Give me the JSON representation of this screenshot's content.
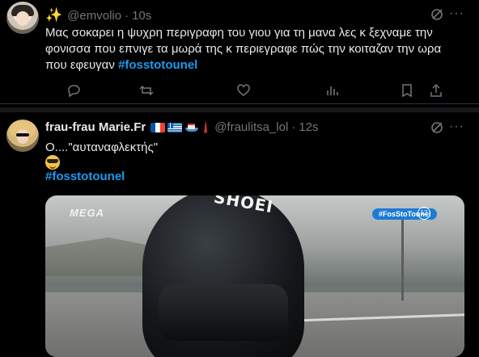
{
  "tweet1": {
    "handle": "@emvolio",
    "time": "10s",
    "text": "Μας σοκαρει η ψυχρη περιγραφη του γιου για τη μανα λες κ ξεχναμε την φονισσα που επνιγε τα μωρά της κ περιεγραφε πώς την κοιταζαν την ωρα που εφευγαν",
    "hashtag": "#fosstotounel",
    "icons": [
      "sparkle-icon",
      "grok-icon",
      "more-icon",
      "reply-icon",
      "retweet-icon",
      "like-icon",
      "views-icon",
      "bookmark-icon",
      "share-icon"
    ]
  },
  "tweet2": {
    "name": "frau-frau Marie.Fr",
    "handle": "@fraulitsa_lol",
    "time": "12s",
    "text": "Ο....\"αυταναφλεκτής\"",
    "hashtag": "#fosstotounel",
    "media": {
      "channel": "MEGA",
      "helmet_brand": "SHOEI",
      "show_tag": "#FosStoTounel",
      "rating": "12"
    },
    "colors": {
      "link": "#1d9bf0",
      "muted": "#71767b",
      "text": "#e7e9ea",
      "background": "#000000"
    }
  },
  "separators": {
    "dot": "·"
  },
  "more_glyph": "···"
}
